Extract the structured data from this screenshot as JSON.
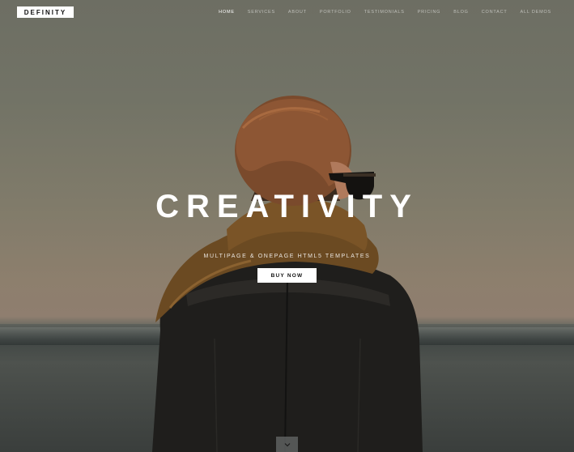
{
  "brand": {
    "logo_text": "DEFINITY"
  },
  "nav": {
    "items": [
      {
        "label": "HOME",
        "active": true
      },
      {
        "label": "SERVICES",
        "active": false
      },
      {
        "label": "ABOUT",
        "active": false
      },
      {
        "label": "PORTFOLIO",
        "active": false
      },
      {
        "label": "TESTIMONIALS",
        "active": false
      },
      {
        "label": "PRICING",
        "active": false
      },
      {
        "label": "BLOG",
        "active": false
      },
      {
        "label": "CONTACT",
        "active": false
      },
      {
        "label": "ALL DEMOS",
        "active": false
      }
    ]
  },
  "hero": {
    "headline": "CREATIVITY",
    "subtitle": "MULTIPAGE & ONEPAGE HTML5 TEMPLATES",
    "cta_label": "BUY NOW",
    "scroll_icon": "chevron-down-icon"
  },
  "colors": {
    "accent": "#ffffff",
    "nav_inactive": "rgba(255,255,255,0.55)"
  }
}
